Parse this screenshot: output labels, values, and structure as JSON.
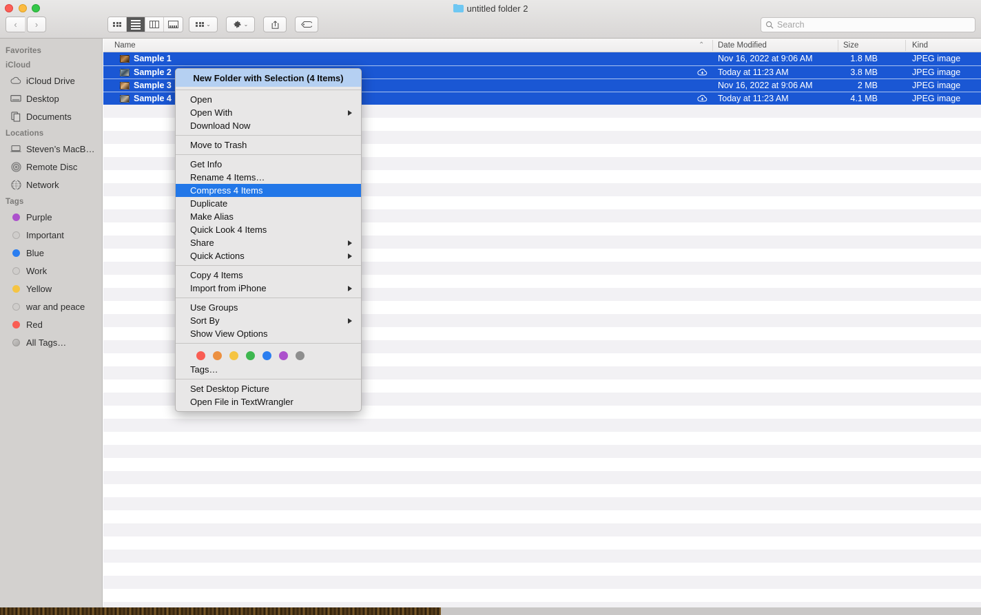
{
  "window": {
    "title": "untitled folder 2",
    "folder_icon": "folder-icon",
    "traffic_lights": [
      "close",
      "minimize",
      "zoom"
    ]
  },
  "toolbar": {
    "back_glyph": "‹",
    "forward_glyph": "›",
    "view_modes": [
      {
        "name": "icon-view",
        "icon": "grid-icon",
        "active": false
      },
      {
        "name": "list-view",
        "icon": "list-icon",
        "active": true
      },
      {
        "name": "column-view",
        "icon": "columns-icon",
        "active": false
      },
      {
        "name": "gallery-view",
        "icon": "gallery-icon",
        "active": false
      }
    ],
    "group_by": {
      "icon": "grid-small-icon",
      "chevron": "⌄"
    },
    "action_menu": {
      "icon": "gear-icon",
      "chevron": "⌄"
    },
    "share": {
      "icon": "share-icon"
    },
    "tags": {
      "icon": "tag-icon"
    }
  },
  "search": {
    "placeholder": "Search",
    "value": "",
    "icon": "search-icon"
  },
  "sidebar": {
    "sections": [
      {
        "header": "Favorites",
        "items": []
      },
      {
        "header": "iCloud",
        "items": [
          {
            "label": "iCloud Drive",
            "icon": "cloud-icon"
          },
          {
            "label": "Desktop",
            "icon": "desktop-icon"
          },
          {
            "label": "Documents",
            "icon": "documents-icon"
          }
        ]
      },
      {
        "header": "Locations",
        "items": [
          {
            "label": "Steven’s MacB…",
            "icon": "laptop-icon"
          },
          {
            "label": "Remote Disc",
            "icon": "disc-icon"
          },
          {
            "label": "Network",
            "icon": "globe-icon"
          }
        ]
      },
      {
        "header": "Tags",
        "items": [
          {
            "label": "Purple",
            "icon": "tag-dot",
            "color": "#ac51cc"
          },
          {
            "label": "Important",
            "icon": "tag-dot",
            "color": ""
          },
          {
            "label": "Blue",
            "icon": "tag-dot",
            "color": "#2b7ef0"
          },
          {
            "label": "Work",
            "icon": "tag-dot",
            "color": ""
          },
          {
            "label": "Yellow",
            "icon": "tag-dot",
            "color": "#f5c443"
          },
          {
            "label": "war and peace",
            "icon": "tag-dot",
            "color": ""
          },
          {
            "label": "Red",
            "icon": "tag-dot",
            "color": "#f95d53"
          },
          {
            "label": "All Tags…",
            "icon": "all-tags-dot",
            "color": ""
          }
        ]
      }
    ]
  },
  "filelist": {
    "columns": [
      {
        "key": "name",
        "label": "Name",
        "sorted": true,
        "sort_glyph": "⌃"
      },
      {
        "key": "date",
        "label": "Date Modified"
      },
      {
        "key": "size",
        "label": "Size"
      },
      {
        "key": "kind",
        "label": "Kind"
      }
    ],
    "rows": [
      {
        "name": "Sample 1",
        "date": "Nov 16, 2022 at 9:06 AM",
        "size": "1.8 MB",
        "kind": "JPEG image",
        "selected": true,
        "cloud": false,
        "thumb": "linear-gradient(135deg,#6b3b1c 0%,#c08a4a 45%,#2a1708 100%)"
      },
      {
        "name": "Sample 2",
        "date": "Today at 11:23 AM",
        "size": "3.8 MB",
        "kind": "JPEG image",
        "selected": true,
        "cloud": true,
        "thumb": "linear-gradient(135deg,#9fb6c4 0%,#3c4f5c 50%,#d9d2c4 100%)"
      },
      {
        "name": "Sample 3",
        "date": "Nov 16, 2022 at 9:06 AM",
        "size": "2 MB",
        "kind": "JPEG image",
        "selected": true,
        "cloud": false,
        "thumb": "linear-gradient(135deg,#8a5a33 0%,#e0b27a 40%,#3b2411 100%)"
      },
      {
        "name": "Sample 4",
        "date": "Today at 11:23 AM",
        "size": "4.1 MB",
        "kind": "JPEG image",
        "selected": true,
        "cloud": true,
        "thumb": "linear-gradient(135deg,#4a5c6e 0%,#c2b49a 55%,#2c2015 100%)"
      }
    ],
    "selected_count": 4
  },
  "context_menu": {
    "items": [
      {
        "label": "New Folder with Selection (4 Items)",
        "style": "first"
      },
      {
        "type": "separator"
      },
      {
        "label": "Open"
      },
      {
        "label": "Open With",
        "submenu": true
      },
      {
        "label": "Download Now"
      },
      {
        "type": "separator"
      },
      {
        "label": "Move to Trash"
      },
      {
        "type": "separator"
      },
      {
        "label": "Get Info"
      },
      {
        "label": "Rename 4 Items…"
      },
      {
        "label": "Compress 4 Items",
        "style": "selected"
      },
      {
        "label": "Duplicate"
      },
      {
        "label": "Make Alias"
      },
      {
        "label": "Quick Look 4 Items"
      },
      {
        "label": "Share",
        "submenu": true
      },
      {
        "label": "Quick Actions",
        "submenu": true
      },
      {
        "type": "separator"
      },
      {
        "label": "Copy 4 Items"
      },
      {
        "label": "Import from iPhone",
        "submenu": true
      },
      {
        "type": "separator"
      },
      {
        "label": "Use Groups"
      },
      {
        "label": "Sort By",
        "submenu": true
      },
      {
        "label": "Show View Options"
      },
      {
        "type": "separator"
      },
      {
        "type": "tags"
      },
      {
        "label": "Tags…"
      },
      {
        "type": "separator"
      },
      {
        "label": "Set Desktop Picture"
      },
      {
        "label": "Open File in TextWrangler"
      }
    ],
    "tag_colors": [
      "#f95d53",
      "#ec9040",
      "#f5c443",
      "#3eb74f",
      "#2b7ef0",
      "#ac51cc",
      "#8e8e8e"
    ]
  },
  "colors": {
    "selection_blue": "#1a57d4",
    "menu_highlight": "#2277e8",
    "menu_first_tint": "#b5d0f2",
    "sidebar_bg": "#d3d1cf",
    "stripe_alt": "#f2f1f4"
  }
}
